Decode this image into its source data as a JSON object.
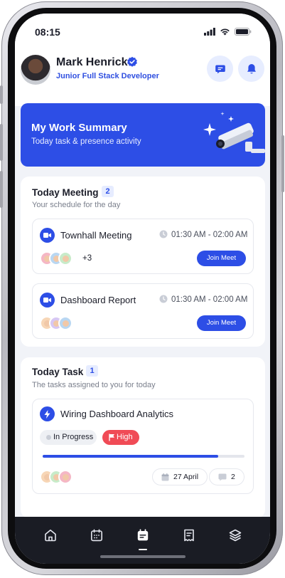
{
  "status_bar": {
    "time": "08:15"
  },
  "header": {
    "user_name": "Mark Henrick",
    "user_role": "Junior Full Stack Developer"
  },
  "banner": {
    "title": "My Work Summary",
    "subtitle": "Today task & presence activity"
  },
  "meetings": {
    "title": "Today Meeting",
    "count": "2",
    "subtitle": "Your schedule for the day",
    "items": [
      {
        "title": "Townhall Meeting",
        "time": "01:30 AM - 02:00 AM",
        "extra_attendees": "+3",
        "button": "Join Meet"
      },
      {
        "title": "Dashboard Report",
        "time": "01:30 AM - 02:00 AM",
        "extra_attendees": "",
        "button": "Join Meet"
      }
    ]
  },
  "tasks": {
    "title": "Today Task",
    "count": "1",
    "subtitle": "The tasks assigned to you for today",
    "items": [
      {
        "title": "Wiring Dashboard Analytics",
        "status": "In Progress",
        "priority": "High",
        "progress": 0.87,
        "due_date": "27 April",
        "comments": "2"
      }
    ]
  },
  "bottom_nav": {
    "items": [
      "home-icon",
      "calendar-icon",
      "calendar-active-icon",
      "receipt-icon",
      "layers-icon"
    ],
    "active_index": 2
  },
  "colors": {
    "accent": "#2D4EE6",
    "priority_high": "#F04B56",
    "nav_background": "#1A1C24"
  }
}
